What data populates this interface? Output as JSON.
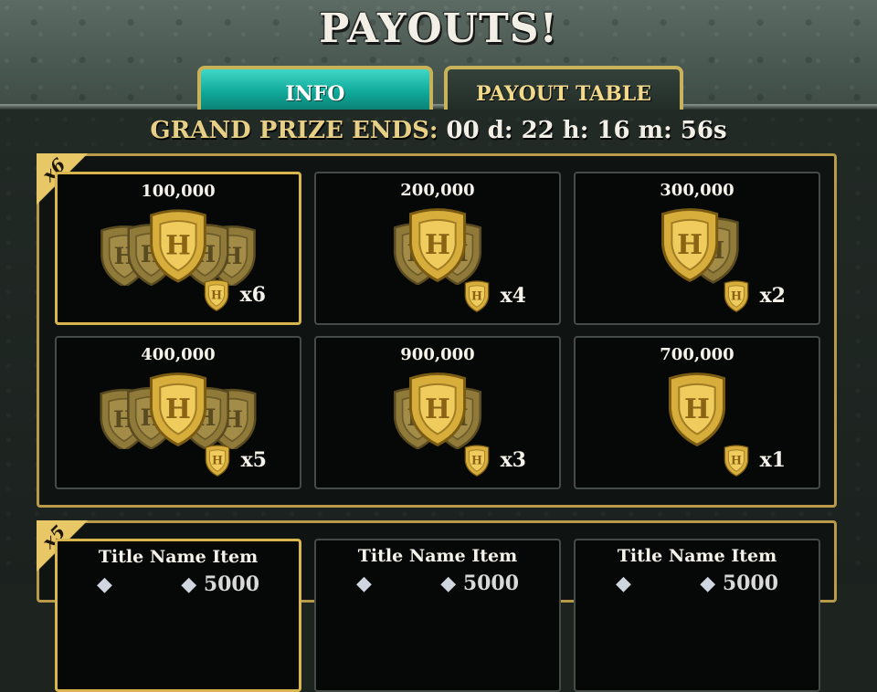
{
  "header": {
    "title": "PAYOUTS!"
  },
  "tabs": [
    {
      "label": "INFO",
      "active": true
    },
    {
      "label": "PAYOUT TABLE",
      "active": false
    }
  ],
  "countdown": {
    "label": "GRAND PRIZE ENDS:",
    "value": "00 d: 22 h: 16 m: 56s"
  },
  "sections": [
    {
      "badge": "x6",
      "cards": [
        {
          "amount": "100,000",
          "multiplier": "x6",
          "icon": "shield-stack-icon",
          "selected": true
        },
        {
          "amount": "200,000",
          "multiplier": "x4",
          "icon": "shield-stack-icon",
          "selected": false
        },
        {
          "amount": "300,000",
          "multiplier": "x2",
          "icon": "shield-stack-icon",
          "selected": false
        },
        {
          "amount": "400,000",
          "multiplier": "x5",
          "icon": "shield-stack-icon",
          "selected": false
        },
        {
          "amount": "900,000",
          "multiplier": "x3",
          "icon": "shield-stack-icon",
          "selected": false
        },
        {
          "amount": "700,000",
          "multiplier": "x1",
          "icon": "shield-icon",
          "selected": false
        }
      ]
    },
    {
      "badge": "x5",
      "cards": [
        {
          "title": "Title Name Item",
          "partial_value": "5000",
          "icon": "gem-icon",
          "selected": true
        },
        {
          "title": "Title Name Item",
          "partial_value": "5000",
          "icon": "gem-icon",
          "selected": false
        },
        {
          "title": "Title Name Item",
          "partial_value": "5000",
          "icon": "gem-icon",
          "selected": false
        }
      ]
    }
  ],
  "colors": {
    "gold": "#d9b54e",
    "teal": "#10a999",
    "background": "#1b211e"
  }
}
